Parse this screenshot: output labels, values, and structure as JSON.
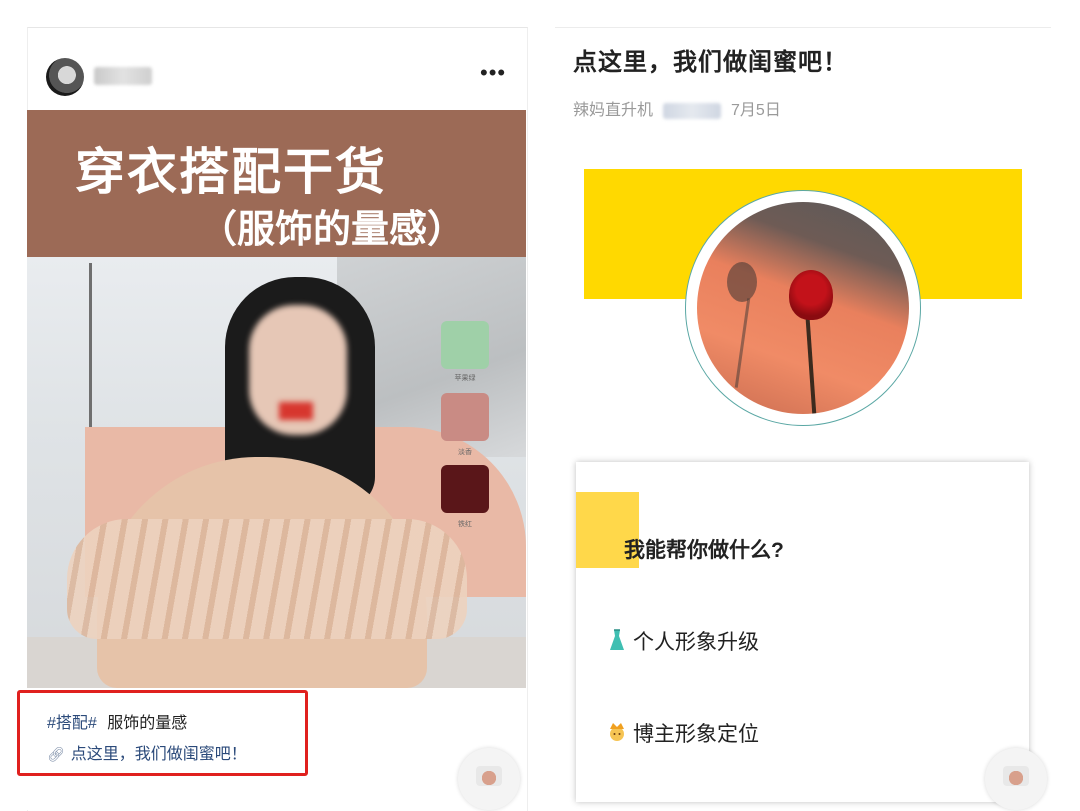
{
  "left_post": {
    "more_icon": "•••",
    "cover": {
      "title": "穿衣搭配干货",
      "subtitle": "（服饰的量感）",
      "swatches": [
        {
          "label": "苹果绿",
          "color": "#9fd0a8"
        },
        {
          "label": "淡香",
          "color": "#c98b84"
        },
        {
          "label": "铁红",
          "color": "#5a1619"
        }
      ]
    },
    "caption": {
      "tag": "#搭配#",
      "text": "服饰的量感",
      "link_text": "点这里，我们做闺蜜吧！"
    }
  },
  "right_article": {
    "title": "点这里，我们做闺蜜吧！",
    "account": "辣妈直升机",
    "date": "7月5日",
    "card": {
      "heading": "我能帮你做什么?",
      "items": [
        {
          "icon": "dress-icon",
          "text": "个人形象升级"
        },
        {
          "icon": "crown-person-icon",
          "text": "博主形象定位"
        }
      ]
    }
  },
  "colors": {
    "banner_brown": "#9c6a56",
    "highlight_red": "#e0201e",
    "yellow": "#ffd900",
    "link_blue": "#2b4a7a"
  }
}
